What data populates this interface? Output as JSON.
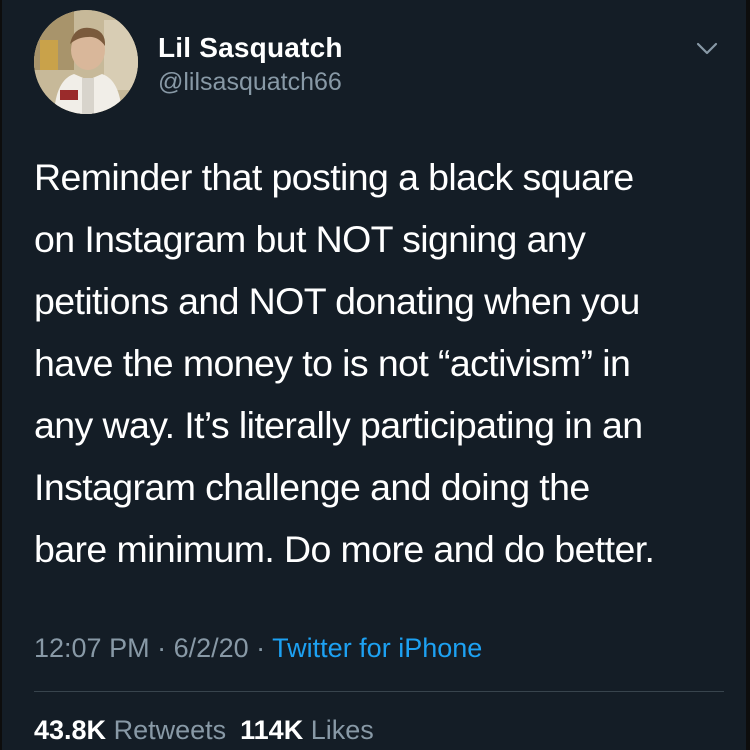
{
  "user": {
    "display_name": "Lil Sasquatch",
    "handle": "@lilsasquatch66"
  },
  "tweet": {
    "lines": [
      "Reminder that posting a black square",
      "on Instagram but NOT signing any",
      "petitions and NOT donating when you",
      "have the money to is not “activism” in",
      "any way. It’s literally participating in an",
      "Instagram challenge and doing the",
      "bare minimum. Do more and do better."
    ]
  },
  "meta": {
    "time": "12:07 PM",
    "separator": " · ",
    "date": "6/2/20",
    "source": "Twitter for iPhone"
  },
  "stats": {
    "retweets_count": "43.8K",
    "retweets_label": "Retweets",
    "likes_count": "114K",
    "likes_label": "Likes"
  },
  "colors": {
    "background": "#141d26",
    "text_primary": "#ffffff",
    "text_secondary": "#8899a6",
    "link": "#1da1f2"
  },
  "icons": {
    "avatar": "profile-photo",
    "menu": "chevron-down-icon"
  }
}
